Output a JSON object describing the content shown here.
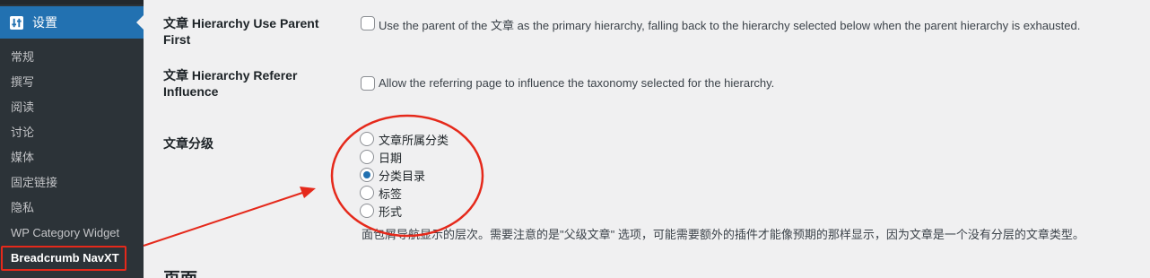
{
  "sidebar": {
    "current_menu": "设置",
    "items": [
      {
        "label": "常规"
      },
      {
        "label": "撰写"
      },
      {
        "label": "阅读"
      },
      {
        "label": "讨论"
      },
      {
        "label": "媒体"
      },
      {
        "label": "固定链接"
      },
      {
        "label": "隐私"
      },
      {
        "label": "WP Category Widget"
      },
      {
        "label": "Breadcrumb NavXT"
      }
    ]
  },
  "settings": {
    "hierarchy_use_parent": {
      "label": "文章 Hierarchy Use Parent First",
      "description": "Use the parent of the 文章 as the primary hierarchy, falling back to the hierarchy selected below when the parent hierarchy is exhausted.",
      "checked": false
    },
    "hierarchy_referer": {
      "label_line1": "文章 Hierarchy Referer",
      "label_line2": "Influence",
      "description": "Allow the referring page to influence the taxonomy selected for the hierarchy.",
      "checked": false
    },
    "post_hierarchy": {
      "label": "文章分级",
      "options": [
        {
          "label": "文章所属分类",
          "checked": false
        },
        {
          "label": "日期",
          "checked": false
        },
        {
          "label": "分类目录",
          "checked": true
        },
        {
          "label": "标签",
          "checked": false
        },
        {
          "label": "形式",
          "checked": false
        }
      ],
      "description": "面包屑导航显示的层次。需要注意的是\"父级文章\" 选项，可能需要额外的插件才能像预期的那样显示，因为文章是一个没有分层的文章类型。"
    }
  },
  "next_section_title": "页面",
  "colors": {
    "sidebar_bg": "#2c3338",
    "accent": "#2271b1",
    "annotation": "#e5291b"
  }
}
